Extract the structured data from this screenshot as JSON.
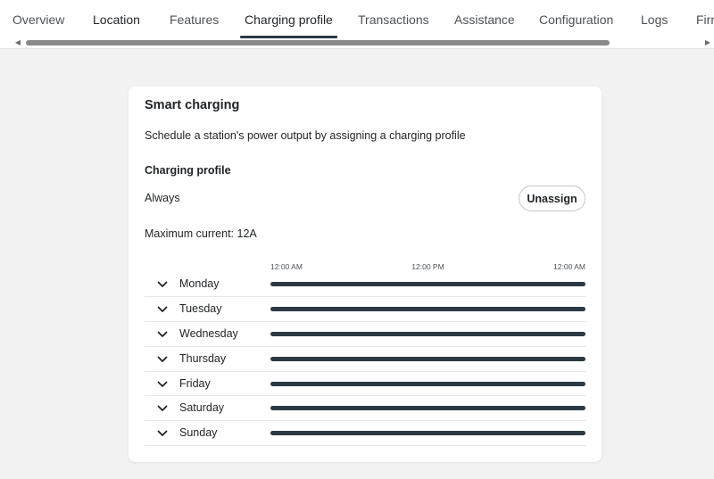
{
  "tabs": [
    {
      "label": "Overview"
    },
    {
      "label": "Location"
    },
    {
      "label": "Features"
    },
    {
      "label": "Charging profile"
    },
    {
      "label": "Transactions"
    },
    {
      "label": "Assistance"
    },
    {
      "label": "Configuration"
    },
    {
      "label": "Logs"
    },
    {
      "label": "Firr"
    }
  ],
  "active_tab": "Charging profile",
  "card": {
    "title": "Smart charging",
    "description": "Schedule a station's power output by assigning a charging profile",
    "section_title": "Charging profile",
    "profile_name": "Always",
    "unassign_label": "Unassign",
    "max_current": "Maximum current: 12A",
    "axis_ticks": [
      "12:00 AM",
      "12:00 PM",
      "12:00 AM"
    ],
    "days": [
      {
        "label": "Monday",
        "coverage": 1.0
      },
      {
        "label": "Tuesday",
        "coverage": 1.0
      },
      {
        "label": "Wednesday",
        "coverage": 1.0
      },
      {
        "label": "Thursday",
        "coverage": 1.0
      },
      {
        "label": "Friday",
        "coverage": 1.0
      },
      {
        "label": "Saturday",
        "coverage": 1.0
      },
      {
        "label": "Sunday",
        "coverage": 1.0
      }
    ]
  },
  "icons": {
    "scroll_left": "triangle-left-icon",
    "scroll_right": "triangle-right-icon",
    "expand": "chevron-down-icon"
  },
  "colors": {
    "accent": "#2b3a44",
    "page_bg": "#f2f2f2",
    "card_bg": "#ffffff"
  }
}
